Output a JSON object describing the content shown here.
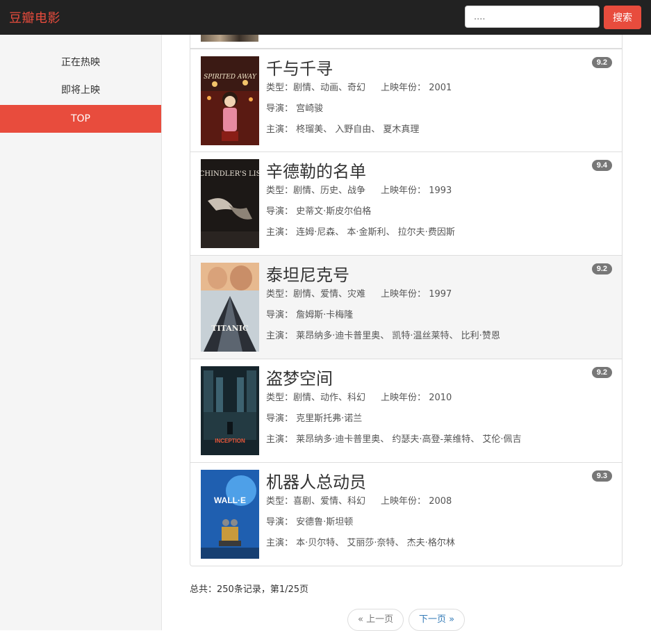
{
  "app": {
    "brand": "豆瓣电影"
  },
  "search": {
    "placeholder": "....",
    "button_label": "搜索"
  },
  "sidebar": {
    "items": [
      {
        "label": "正在热映",
        "active": false
      },
      {
        "label": "即将上映",
        "active": false
      },
      {
        "label": "TOP",
        "active": true
      }
    ]
  },
  "labels": {
    "genre": "类型：",
    "year": "上映年份：",
    "director": "导演：",
    "cast": "主演："
  },
  "movies": [
    {
      "title": "千与千寻",
      "genres": "剧情、动画、奇幻",
      "year": "2001",
      "director": "宫崎骏",
      "cast": "柊瑠美、 入野自由、 夏木真理",
      "rating": "9.2",
      "poster_icon": "spirited-away-poster"
    },
    {
      "title": "辛德勒的名单",
      "genres": "剧情、历史、战争",
      "year": "1993",
      "director": "史蒂文·斯皮尔伯格",
      "cast": "连姆·尼森、 本·金斯利、 拉尔夫·费因斯",
      "rating": "9.4",
      "poster_icon": "schindlers-list-poster"
    },
    {
      "title": "泰坦尼克号",
      "genres": "剧情、爱情、灾难",
      "year": "1997",
      "director": "詹姆斯·卡梅隆",
      "cast": "莱昂纳多·迪卡普里奥、 凯特·温丝莱特、 比利·赞恩",
      "rating": "9.2",
      "poster_icon": "titanic-poster"
    },
    {
      "title": "盗梦空间",
      "genres": "剧情、动作、科幻",
      "year": "2010",
      "director": "克里斯托弗·诺兰",
      "cast": "莱昂纳多·迪卡普里奥、 约瑟夫·高登-莱维特、 艾伦·佩吉",
      "rating": "9.2",
      "poster_icon": "inception-poster"
    },
    {
      "title": "机器人总动员",
      "genres": "喜剧、爱情、科幻",
      "year": "2008",
      "director": "安德鲁·斯坦顿",
      "cast": "本·贝尔特、 艾丽莎·奈特、 杰夫·格尔林",
      "rating": "9.3",
      "poster_icon": "wall-e-poster"
    }
  ],
  "pagination": {
    "summary": "总共：250条记录，第1/25页",
    "prev_label": "« 上一页",
    "next_label": "下一页 »"
  },
  "colors": {
    "accent": "#e84c3d",
    "navbar": "#222222",
    "badge": "#777777",
    "link": "#337ab7"
  }
}
